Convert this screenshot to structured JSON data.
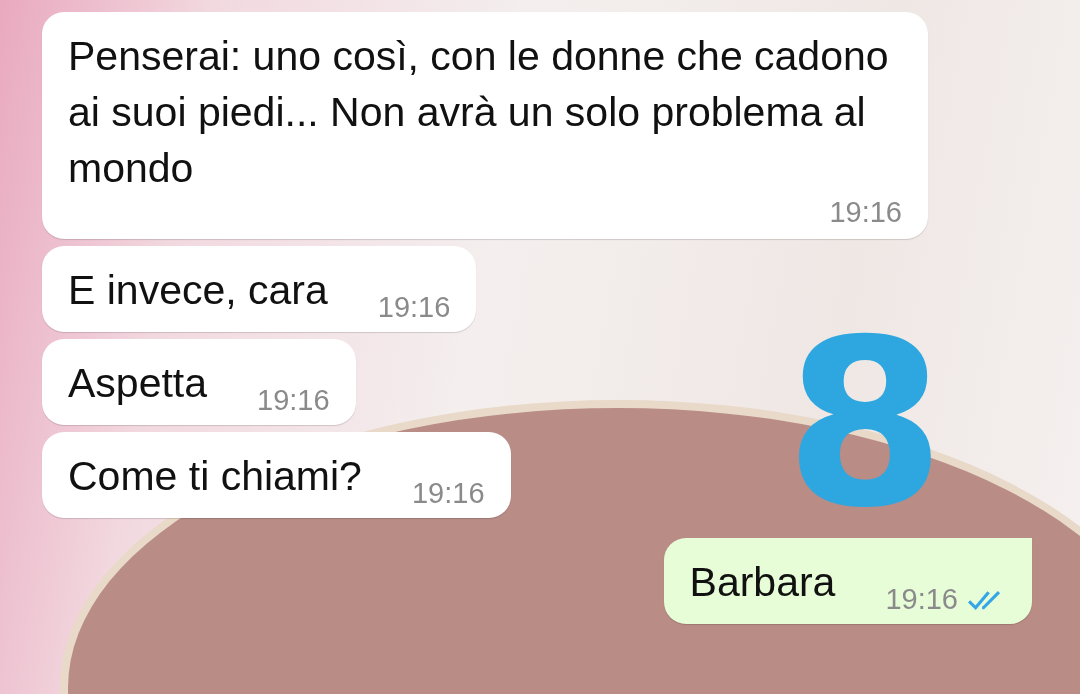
{
  "messages": [
    {
      "outgoing": false,
      "text": "Penserai: uno così, con le donne che cadono ai suoi piedi... Non avrà un solo problema al mondo",
      "time": "19:16"
    },
    {
      "outgoing": false,
      "text": "E invece, cara",
      "time": "19:16"
    },
    {
      "outgoing": false,
      "text": "Aspetta",
      "time": "19:16"
    },
    {
      "outgoing": false,
      "text": "Come ti chiami?",
      "time": "19:16"
    },
    {
      "outgoing": true,
      "text": "Barbara",
      "time": "19:16",
      "read": true
    }
  ],
  "annotation": "8"
}
